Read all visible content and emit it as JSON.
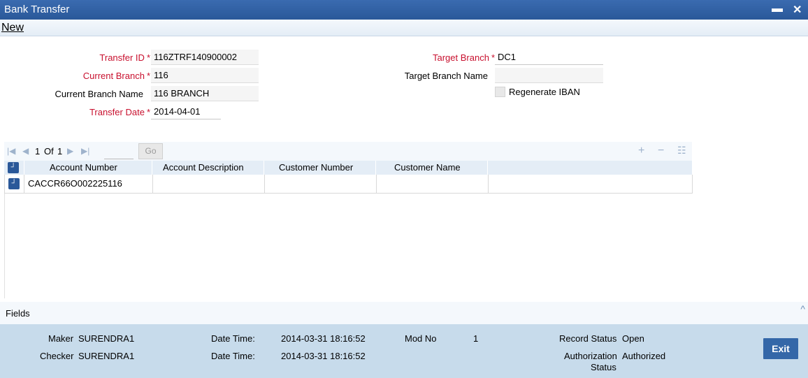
{
  "window": {
    "title": "Bank Transfer",
    "minimize": "▬",
    "close": "✕"
  },
  "menu": {
    "new_label": "New"
  },
  "form": {
    "transfer_id": {
      "label": "Transfer ID",
      "value": "116ZTRF140900002"
    },
    "current_branch": {
      "label": "Current Branch",
      "value": "116"
    },
    "current_branch_name": {
      "label": "Current Branch Name",
      "value": "116 BRANCH"
    },
    "transfer_date": {
      "label": "Transfer Date",
      "value": "2014-04-01"
    },
    "target_branch": {
      "label": "Target Branch",
      "value": "DC1"
    },
    "target_branch_name": {
      "label": "Target Branch Name",
      "value": ""
    },
    "regenerate_iban": {
      "label": "Regenerate IBAN",
      "checked": false
    },
    "required_mark": "*"
  },
  "grid": {
    "pager": {
      "current": "1",
      "of_label": "Of",
      "total": "1",
      "go_label": "Go",
      "go_value": ""
    },
    "columns": [
      "Account Number",
      "Account Description",
      "Customer Number",
      "Customer Name"
    ],
    "rows": [
      {
        "account_number": "CACCR66O002225116",
        "account_description": "",
        "customer_number": "",
        "customer_name": ""
      }
    ],
    "icons": {
      "first": "first-page-icon",
      "prev": "prev-page-icon",
      "next": "next-page-icon",
      "last": "last-page-icon",
      "add": "add-row-icon",
      "remove": "delete-row-icon",
      "view": "single-view-icon"
    }
  },
  "fields_section": {
    "label": "Fields"
  },
  "audit": {
    "maker_label": "Maker",
    "maker": "SURENDRA1",
    "checker_label": "Checker",
    "checker": "SURENDRA1",
    "datetime_label": "Date Time:",
    "maker_datetime": "2014-03-31 18:16:52",
    "checker_datetime": "2014-03-31 18:16:52",
    "mod_no_label": "Mod No",
    "mod_no": "1",
    "record_status_label": "Record Status",
    "record_status": "Open",
    "auth_status_label_1": "Authorization",
    "auth_status_label_2": "Status",
    "auth_status": "Authorized"
  },
  "exit_label": "Exit",
  "colors": {
    "title_bar": "#2a5899",
    "required": "#c8102e",
    "footer": "#c7dbeb",
    "exit_button": "#3467a8"
  }
}
